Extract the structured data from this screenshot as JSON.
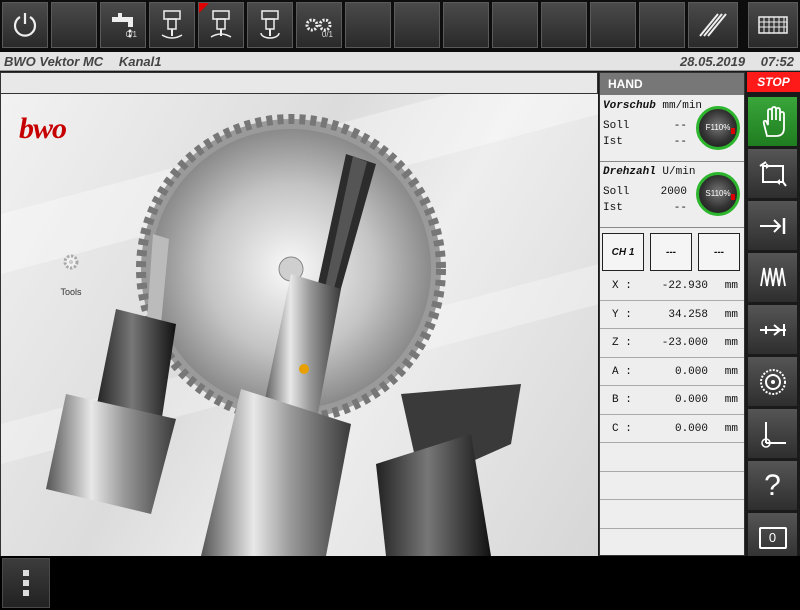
{
  "status": {
    "machine": "BWO Vektor MC",
    "channel": "Kanal1",
    "date": "28.05.2019",
    "time": "07:52"
  },
  "toolbar": {
    "coolant_count": "0/1",
    "counter_count": "0/1"
  },
  "main": {
    "logo_text": "bwo",
    "tools_label": "Tools"
  },
  "panel": {
    "mode": "HAND",
    "feed": {
      "title": "Vorschub",
      "unit": "mm/min",
      "soll_label": "Soll",
      "soll": "--",
      "ist_label": "Ist",
      "ist": "--",
      "override": "F110%"
    },
    "spindle": {
      "title": "Drehzahl",
      "unit": "U/min",
      "soll_label": "Soll",
      "soll": "2000",
      "ist_label": "Ist",
      "ist": "--",
      "override": "S110%"
    },
    "channels": [
      "CH 1",
      "---",
      "---"
    ],
    "axes": [
      {
        "name": "X :",
        "value": "-22.930",
        "unit": "mm"
      },
      {
        "name": "Y :",
        "value": "34.258",
        "unit": "mm"
      },
      {
        "name": "Z :",
        "value": "-23.000",
        "unit": "mm"
      },
      {
        "name": "A :",
        "value": "0.000",
        "unit": "mm"
      },
      {
        "name": "B :",
        "value": "0.000",
        "unit": "mm"
      },
      {
        "name": "C :",
        "value": "0.000",
        "unit": "mm"
      }
    ]
  },
  "sidebar": {
    "stop_label": "STOP",
    "help_label": "?",
    "counter_label": "0"
  },
  "colors": {
    "accent_green": "#2db52d",
    "stop_red": "#ff1a1a",
    "logo_red": "#c60000"
  }
}
